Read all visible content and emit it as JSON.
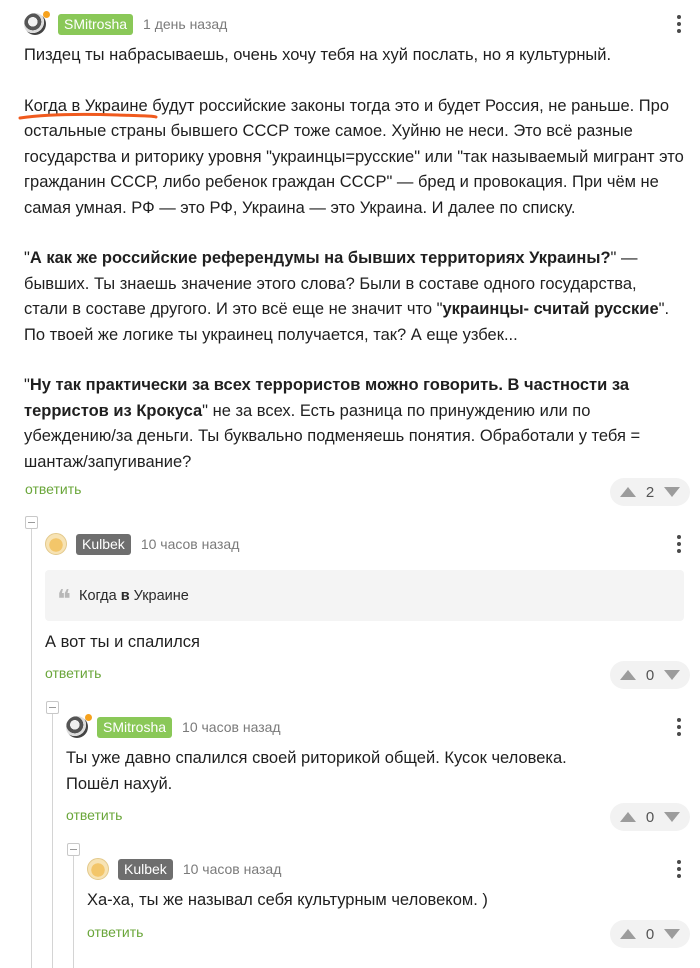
{
  "colors": {
    "accent_green": "#8ac858",
    "reply_green": "#6aa63a",
    "nick_gray": "#6e6e6e",
    "underline_orange": "#f05a1e"
  },
  "c1": {
    "nick": "SMitrosha",
    "time": "1 день назад",
    "p1": "Пиздец ты набрасываешь, очень хочу тебя на хуй послать, но я культурный.",
    "p2": "Когда в Украине будут российские законы тогда это и будет Россия, не раньше. Про остальные страны бывшего СССР тоже самое. Хуйню не неси. Это всё разные государства и риторику уровня \"украинцы=русские\" или \"так называемый мигрант это гражданин СССР, либо ребенок граждан СССР\" — бред и провокация. При чём не самая умная. РФ — это РФ, Украина — это Украина. И далее по списку.",
    "p3_q1": "\"",
    "p3_bold": "А как же российские референдумы на бывших территориях Украины?",
    "p3_mid": "\" — бывших. Ты знаешь значение этого слова? Были в составе одного государства, стали в составе другого. И это всё еще не значит что \"",
    "p3_bold2": "украинцы- считай русские",
    "p3_end": "\". По твоей же логике ты украинец получается, так? А еще узбек...",
    "p4_q1": "\"",
    "p4_bold": "Ну так практически за всех террористов можно говорить. В частности за терристов из Крокуса",
    "p4_end": "\" не за всех. Есть разница по принуждению или по убеждению/за деньги. Ты буквально подменяешь понятия. Обработали у тебя = шантаж/запугивание?",
    "reply": "ответить",
    "votes": "2"
  },
  "c2": {
    "nick": "Kulbek",
    "time": "10 часов назад",
    "quote_a": "Когда ",
    "quote_b": "в",
    "quote_c": " Украине",
    "text": "А вот ты и спалился",
    "reply": "ответить",
    "votes": "0"
  },
  "c3": {
    "nick": "SMitrosha",
    "time": "10 часов назад",
    "line1": "Ты уже давно спалился своей риторикой общей. Кусок человека.",
    "line2": "Пошёл нахуй.",
    "reply": "ответить",
    "votes": "0"
  },
  "c4": {
    "nick": "Kulbek",
    "time": "10 часов назад",
    "text": "Ха-ха, ты же называл себя культурным человеком. )",
    "reply": "ответить",
    "votes": "0"
  }
}
